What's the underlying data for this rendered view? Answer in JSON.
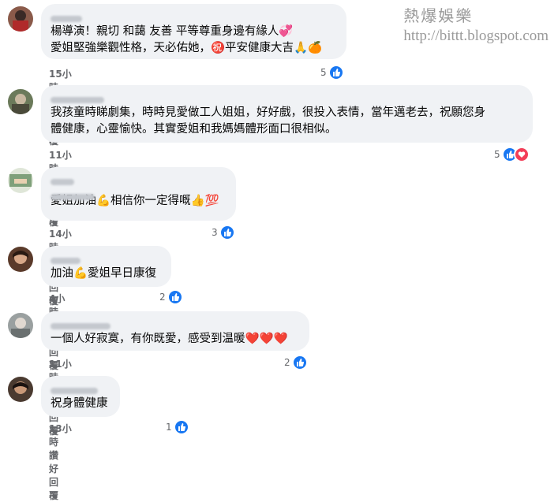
{
  "watermark": {
    "title": "熱爆娛樂",
    "url": "http://bittt.blogspot.com"
  },
  "comments": [
    {
      "lines": [
        "楊導演！親切 和藹 友善 平等尊重身邊有緣人💞",
        "愛姐堅強樂觀性格，天必佑她，㊗️平安健康大吉🙏🍊"
      ],
      "time": "15小時",
      "like_label": "讚好",
      "reply_label": "回覆",
      "reaction_count": "5"
    },
    {
      "lines": [
        "我孩童時睇劇集，時時見愛做工人姐姐，好好戲，很投入表情，當年邁老去，祝願您身",
        "體健康，心靈愉快。其實愛姐和我媽媽體形面口很相似。"
      ],
      "time": "11小時",
      "like_label": "讚好",
      "reply_label": "回覆",
      "reaction_count": "5"
    },
    {
      "lines": [
        "愛姐加油💪相信你一定得嘅👍💯"
      ],
      "time": "14小時",
      "like_label": "讚好",
      "reply_label": "回覆",
      "reaction_count": "3"
    },
    {
      "lines": [
        "加油💪愛姐早日康復"
      ],
      "time": "4小時",
      "like_label": "讚好",
      "reply_label": "回覆",
      "reaction_count": "2"
    },
    {
      "lines": [
        "一個人好寂寞，有你既愛，感受到温暖❤️❤️❤️"
      ],
      "time": "11小時",
      "like_label": "讚好",
      "reply_label": "回覆",
      "reaction_count": "2"
    },
    {
      "lines": [
        "祝身體健康"
      ],
      "time": "13小時",
      "like_label": "讚好",
      "reply_label": "回覆",
      "reaction_count": "1"
    }
  ],
  "icons": {
    "like": "thumbs-up-icon",
    "love": "heart-icon"
  },
  "colors": {
    "bubble": "#f0f2f5",
    "meta_text": "#65676b",
    "like_blue": "#1877f2",
    "love_red": "#f33e58"
  }
}
